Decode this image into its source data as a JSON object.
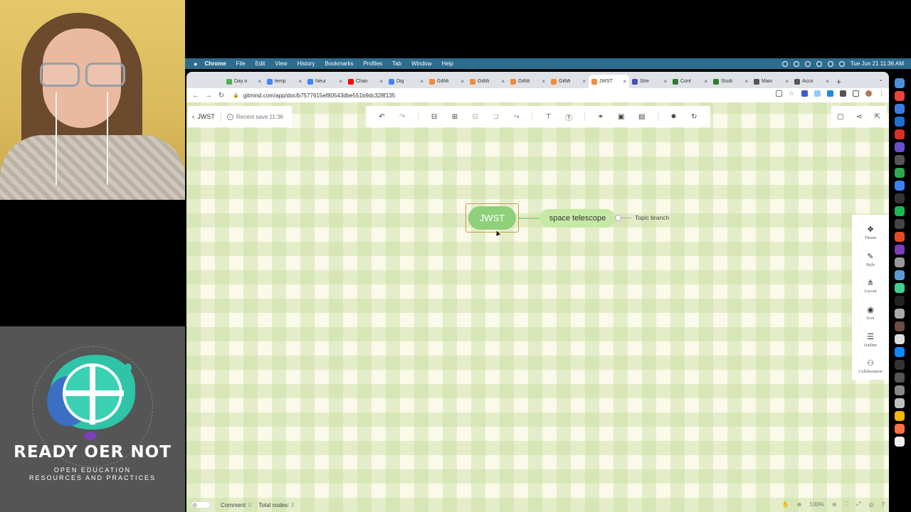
{
  "menubar": {
    "app": "Chrome",
    "items": [
      "File",
      "Edit",
      "View",
      "History",
      "Bookmarks",
      "Profiles",
      "Tab",
      "Window",
      "Help"
    ],
    "clock": "Tue Jun 21  11:36 AM"
  },
  "tabs": [
    {
      "label": "Day o",
      "color": "#4caf50"
    },
    {
      "label": "temp",
      "color": "#4285f4"
    },
    {
      "label": "Neur",
      "color": "#4285f4"
    },
    {
      "label": "Chan",
      "color": "#ff0000"
    },
    {
      "label": "Dig",
      "color": "#4285f4"
    },
    {
      "label": "GitMi",
      "color": "#f08a3c"
    },
    {
      "label": "GitMi",
      "color": "#f08a3c"
    },
    {
      "label": "GitMi",
      "color": "#f08a3c"
    },
    {
      "label": "GitMi",
      "color": "#f08a3c"
    },
    {
      "label": "JWST",
      "color": "#f08a3c",
      "active": true
    },
    {
      "label": "Stre",
      "color": "#3f51b5"
    },
    {
      "label": "Cont",
      "color": "#2e7d32"
    },
    {
      "label": "Studi",
      "color": "#2e7d32"
    },
    {
      "label": "Main",
      "color": "#555555"
    },
    {
      "label": "Acco",
      "color": "#555555"
    }
  ],
  "address": {
    "url": "gitmind.com/app/doc/b7577615ef80543dbe551b9dc328f135"
  },
  "doc": {
    "title": "JWST",
    "save_status": "Recent save 11:36"
  },
  "right_panel": {
    "items": [
      {
        "label": "Theme",
        "icon": "theme-icon",
        "glyph": "❖"
      },
      {
        "label": "Style",
        "icon": "style-icon",
        "glyph": "✎"
      },
      {
        "label": "Layout",
        "icon": "layout-icon",
        "glyph": "⋔"
      },
      {
        "label": "Icon",
        "icon": "icon-icon",
        "glyph": "◉"
      },
      {
        "label": "Outline",
        "icon": "outline-icon",
        "glyph": "☰"
      },
      {
        "label": "Collaboration",
        "icon": "collaboration-icon",
        "glyph": "⚇"
      }
    ]
  },
  "mindmap": {
    "root": "JWST",
    "child": "space telescope",
    "branch": "Topic branch"
  },
  "footer": {
    "comment_label": "Comment:",
    "comment_count": "0",
    "nodes_label": "Total nodes:",
    "nodes_count": "3",
    "zoom": "100%"
  },
  "logo": {
    "title": "READY OER NOT",
    "subtitle_line1": "OPEN EDUCATION",
    "subtitle_line2": "RESOURCES AND PRACTICES",
    "ring_text": "learn to teach to learn to teach to learn to"
  },
  "colors": {
    "root_node": "#8fd07a",
    "child_node": "#c6eaa5",
    "menubar": "#2c6c8e",
    "logo_bg": "#555555"
  }
}
